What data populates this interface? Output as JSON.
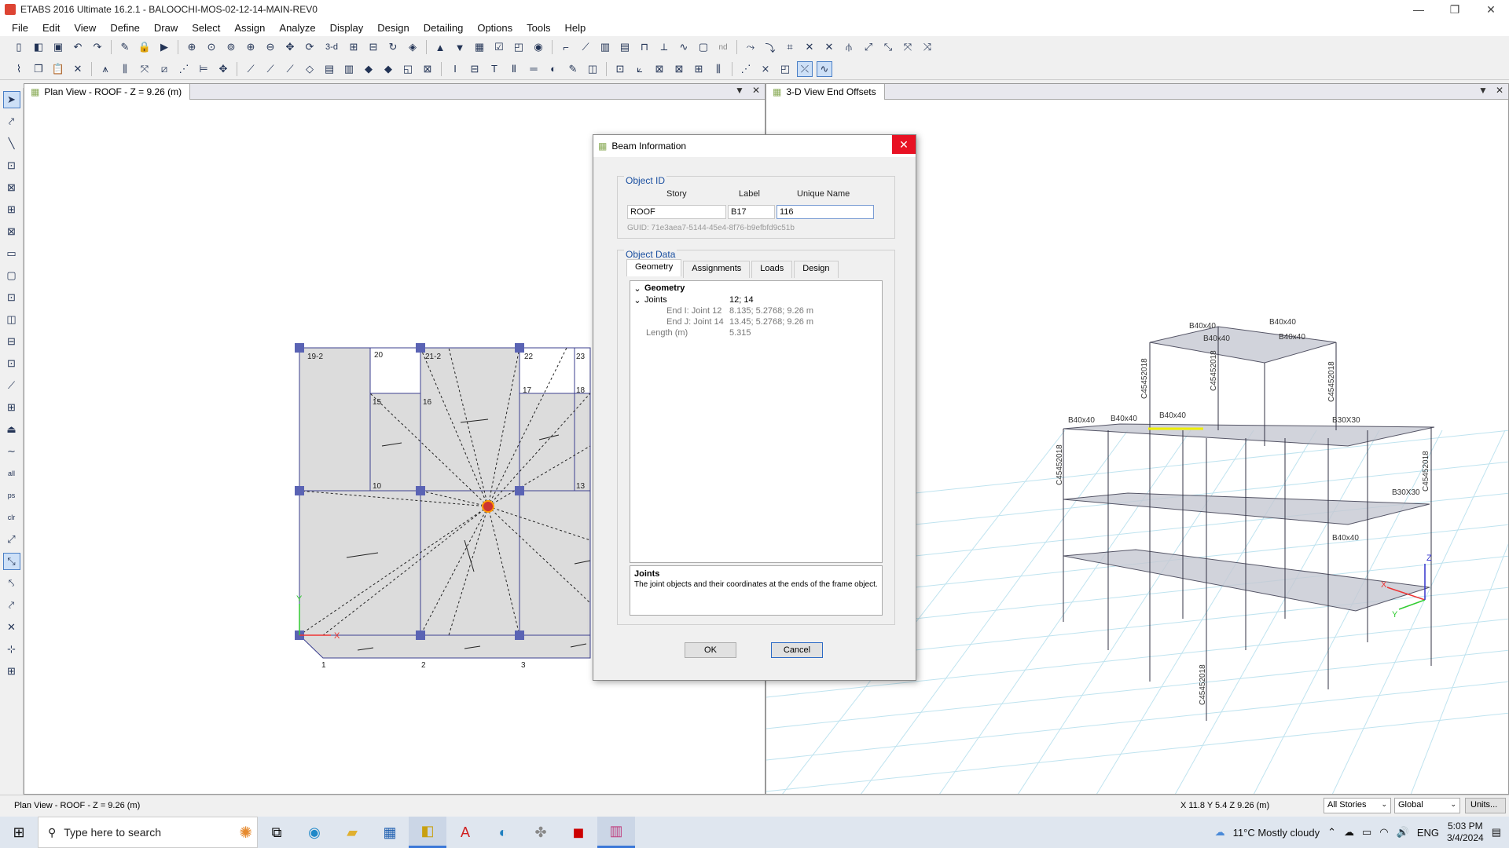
{
  "window": {
    "title": "ETABS 2016 Ultimate 16.2.1 - BALOOCHI-MOS-02-12-14-MAIN-REV0",
    "min": "—",
    "restore": "❐",
    "close": "✕"
  },
  "menu": [
    "File",
    "Edit",
    "View",
    "Define",
    "Draw",
    "Select",
    "Assign",
    "Analyze",
    "Display",
    "Design",
    "Detailing",
    "Options",
    "Tools",
    "Help"
  ],
  "toolbar": {
    "text_3d": "3-d",
    "text_nd": "nd"
  },
  "plan_view": {
    "tab_label": "Plan View - ROOF - Z = 9.26 (m)",
    "labels": {
      "g19": "19-2",
      "g20": "20",
      "g21": "21-2",
      "g22": "22",
      "g23": "23",
      "g15": "15",
      "g16": "16",
      "g17": "17",
      "g18": "18",
      "g10": "10",
      "g13": "13",
      "ax1": "1",
      "ax2": "2",
      "ax3": "3",
      "x": "X",
      "y": "Y"
    }
  },
  "view_3d": {
    "tab_label": "3-D View  End Offsets",
    "labels": {
      "b1": "B40x40",
      "b2": "B40x40",
      "b3": "B40x40",
      "b4": "B40x40",
      "b5": "B30X30",
      "b6": "B40x40",
      "b7": "B40x40",
      "b8": "B40x40",
      "b9": "B30X30",
      "b10": "B40x40",
      "c1": "C45452018",
      "c2": "C45452018",
      "c3": "C45452018",
      "c4": "C45452018",
      "c5": "C45452018",
      "c6": "C45452018",
      "x": "X",
      "y": "Y",
      "z": "Z"
    }
  },
  "dialog": {
    "title": "Beam Information",
    "object_id_title": "Object ID",
    "headers": {
      "story": "Story",
      "label": "Label",
      "unique": "Unique Name"
    },
    "values": {
      "story": "ROOF",
      "label": "B17",
      "unique": "116"
    },
    "guid": "GUID:  71e3aea7-5144-45e4-8f76-b9efbfd9c51b",
    "object_data_title": "Object Data",
    "tabs": [
      "Geometry",
      "Assignments",
      "Loads",
      "Design"
    ],
    "tree": {
      "geometry": "Geometry",
      "joints": "Joints",
      "joints_val": "12; 14",
      "end_i": "End I: Joint 12",
      "end_i_val": "8.135; 5.2768; 9.26 m",
      "end_j": "End J: Joint 14",
      "end_j_val": "13.45; 5.2768; 9.26 m",
      "length": "Length (m)",
      "length_val": "5.315"
    },
    "description": {
      "title": "Joints",
      "text": "The joint objects and their coordinates at the ends of the frame object."
    },
    "ok": "OK",
    "cancel": "Cancel"
  },
  "status": {
    "left": "Plan View - ROOF - Z = 9.26 (m)",
    "coords": "X 11.8  Y 5.4  Z 9.26 (m)",
    "stories": "All Stories",
    "system": "Global",
    "units": "Units..."
  },
  "taskbar": {
    "search_placeholder": "Type here to search",
    "weather": "11°C  Mostly cloudy",
    "lang": "ENG",
    "time": "5:03 PM",
    "date": "3/4/2024"
  }
}
